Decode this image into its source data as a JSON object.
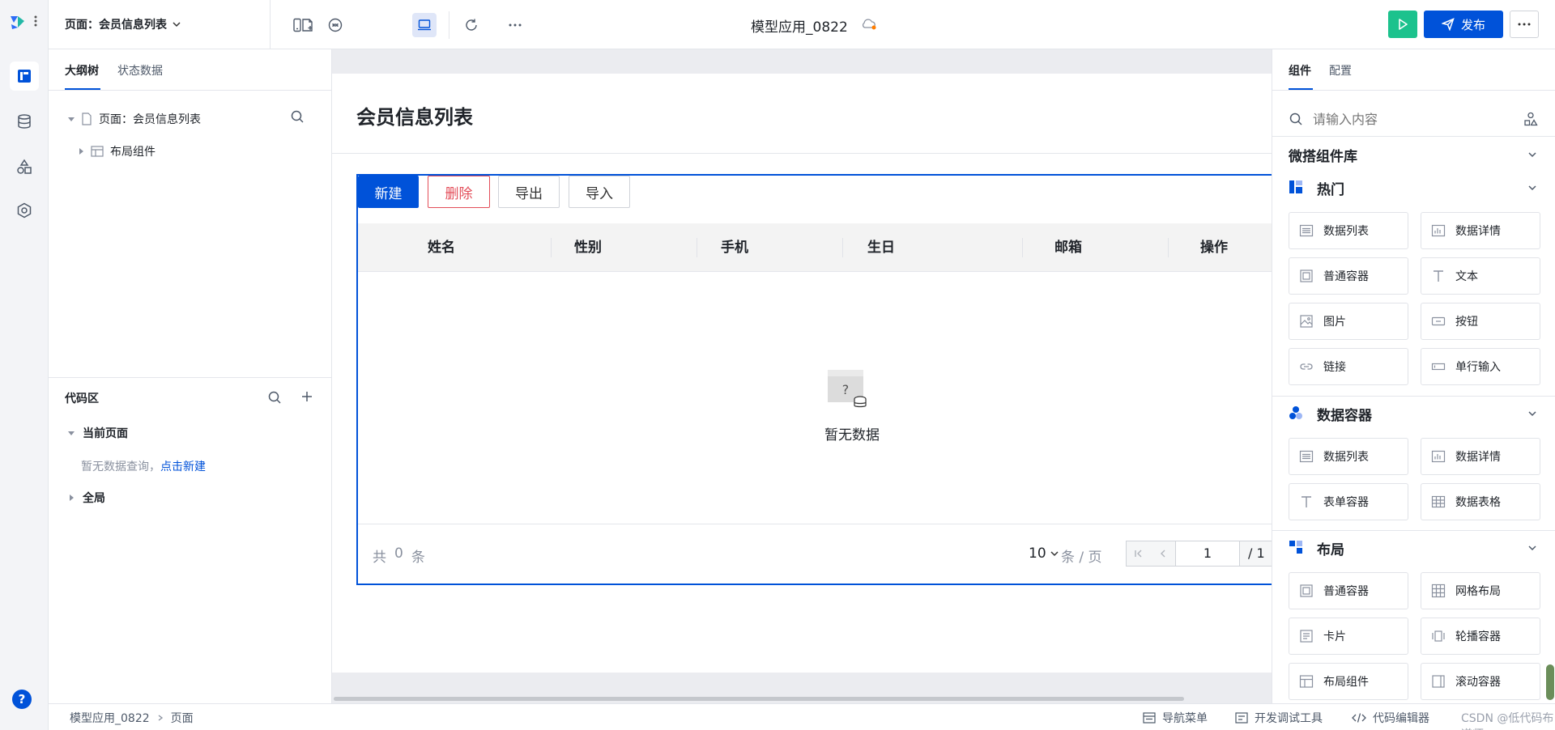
{
  "top": {
    "page_select_label": "页面：会员信息列表",
    "app_title": "模型应用_0822",
    "publish_label": "发布"
  },
  "left_panel": {
    "tabs": [
      "大纲树",
      "状态数据"
    ],
    "tree": {
      "page_node": "页面：会员信息列表",
      "layout_node": "布局组件"
    },
    "code_area": {
      "title": "代码区",
      "current_page": "当前页面",
      "empty_hint": "暂无数据查询，",
      "create_link": "点击新建",
      "global": "全局"
    }
  },
  "canvas": {
    "page_title": "会员信息列表",
    "buttons": {
      "new": "新建",
      "delete": "删除",
      "export": "导出",
      "import": "导入"
    },
    "columns": [
      "姓名",
      "性别",
      "手机",
      "生日",
      "邮箱",
      "操作"
    ],
    "empty_text": "暂无数据",
    "pagination": {
      "total_prefix": "共",
      "total_count": "0",
      "total_suffix": "条",
      "page_size": "10",
      "page_size_unit": "条 / 页",
      "current_page": "1",
      "page_total": "/ 1"
    }
  },
  "right_panel": {
    "tabs": [
      "组件",
      "配置"
    ],
    "search_placeholder": "请输入内容",
    "library_title": "微搭组件库",
    "sections": [
      {
        "title": "热门",
        "items": [
          "数据列表",
          "数据详情",
          "普通容器",
          "文本",
          "图片",
          "按钮",
          "链接",
          "单行输入"
        ]
      },
      {
        "title": "数据容器",
        "items": [
          "数据列表",
          "数据详情",
          "表单容器",
          "数据表格"
        ]
      },
      {
        "title": "布局",
        "items": [
          "普通容器",
          "网格布局",
          "卡片",
          "轮播容器",
          "布局组件",
          "滚动容器"
        ]
      }
    ]
  },
  "status_bar": {
    "breadcrumb": [
      "模型应用_0822",
      "页面"
    ],
    "nav_menu": "导航菜单",
    "dev_tools": "开发调试工具",
    "code_editor": "代码编辑器",
    "watermark": "CSDN @低代码布道师"
  },
  "colors": {
    "primary": "#0052d9",
    "run_green": "#1cc28d",
    "danger": "#e34d59"
  }
}
